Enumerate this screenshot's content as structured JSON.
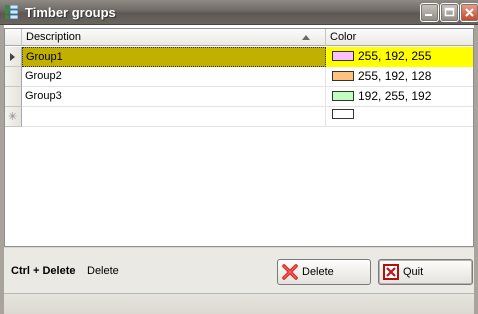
{
  "window": {
    "title": "Timber groups",
    "icons": {
      "app": "grid-app-icon",
      "minimize": "minimize-icon",
      "maximize": "maximize-icon",
      "close": "close-icon"
    }
  },
  "grid": {
    "columns": [
      "Description",
      "Color"
    ],
    "sort": {
      "column": "Description",
      "direction": "ascending"
    },
    "rows": [
      {
        "description": "Group1",
        "color": "255, 192, 255",
        "swatch": "#ffc0ff",
        "selected": true
      },
      {
        "description": "Group2",
        "color": "255, 192, 128",
        "swatch": "#ffc080",
        "selected": false
      },
      {
        "description": "Group3",
        "color": "192, 255, 192",
        "swatch": "#c0ffc0",
        "selected": false
      }
    ],
    "new_row": {
      "description": "",
      "color": "",
      "swatch": "#ffffff"
    },
    "selection_colors": {
      "description_bg": "#c2b000",
      "color_bg": "#ffff00"
    }
  },
  "footer": {
    "shortcut_key": "Ctrl + Delete",
    "shortcut_desc": "Delete",
    "delete_label": "Delete",
    "quit_label": "Quit",
    "delete_icon": "red-x-icon",
    "quit_icon": "exit-icon"
  }
}
